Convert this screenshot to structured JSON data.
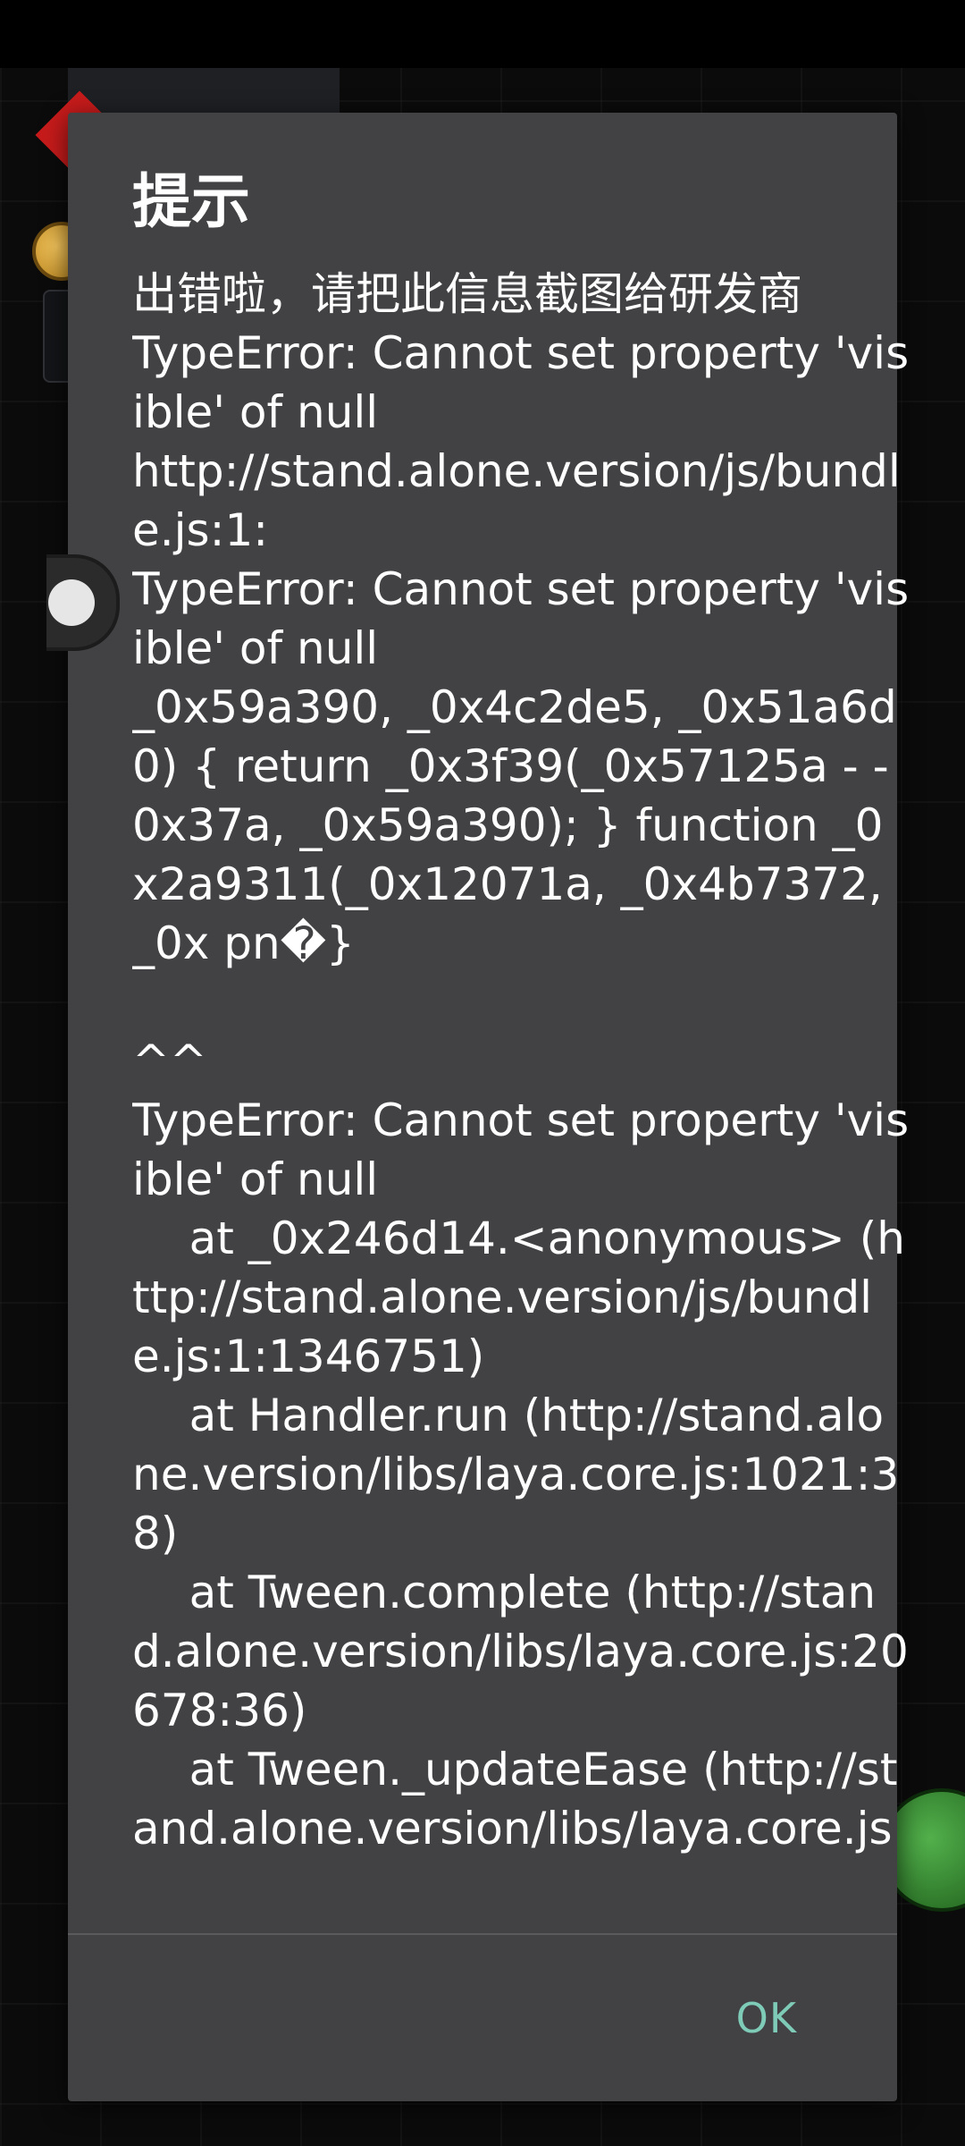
{
  "dialog": {
    "title": "提示",
    "message": "出错啦，请把此信息截图给研发商\nTypeError: Cannot set property 'visible' of null\nhttp://stand.alone.version/js/bundle.js:1:\nTypeError: Cannot set property 'visible' of null\n_0x59a390, _0x4c2de5, _0x51a6d0) { return _0x3f39(_0x57125a - -0x37a, _0x59a390); } function _0x2a9311(_0x12071a, _0x4b7372, _0x pn�}\n\n^^\nTypeError: Cannot set property 'visible' of null\n    at _0x246d14.<anonymous> (http://stand.alone.version/js/bundle.js:1:1346751)\n    at Handler.run (http://stand.alone.version/libs/laya.core.js:1021:38)\n    at Tween.complete (http://stand.alone.version/libs/laya.core.js:20678:36)\n    at Tween._updateEase (http://stand.alone.version/libs/laya.core.js",
    "ok_label": "OK"
  },
  "colors": {
    "dialog_background": "#424244",
    "accent": "#7ecbb8",
    "text": "#ffffff"
  },
  "icons": {
    "floating_handle": "floating-ball-icon"
  }
}
